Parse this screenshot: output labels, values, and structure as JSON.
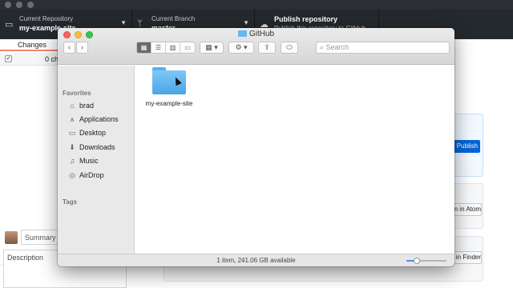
{
  "app": {
    "repository": {
      "label": "Current Repository",
      "value": "my-example-site"
    },
    "branch": {
      "label": "Current Branch",
      "value": "master"
    },
    "publish": {
      "label": "Publish repository",
      "sub": "Publish this repository to GitHub"
    },
    "sidebar": {
      "tab_changes": "Changes",
      "changes_count": "0 changed files",
      "summary_placeholder": "Summary (required)",
      "description_placeholder": "Description"
    },
    "main": {
      "publish_button": "Publish repository",
      "atom_button": "Open in Atom",
      "finder_button": "Show in Finder"
    }
  },
  "finder": {
    "title": "GitHub",
    "search_placeholder": "Search",
    "sidebar": {
      "favorites_heading": "Favorites",
      "tags_heading": "Tags",
      "items": [
        {
          "label": "brad",
          "icon": "home-icon"
        },
        {
          "label": "Applications",
          "icon": "applications-icon"
        },
        {
          "label": "Desktop",
          "icon": "desktop-icon"
        },
        {
          "label": "Downloads",
          "icon": "downloads-icon"
        },
        {
          "label": "Music",
          "icon": "music-icon"
        },
        {
          "label": "AirDrop",
          "icon": "airdrop-icon"
        }
      ]
    },
    "content": {
      "items": [
        {
          "name": "my-example-site",
          "icon": "folder-icon"
        }
      ]
    },
    "status": "1 item, 241.06 GB available",
    "icon_size_fraction": 0.25
  }
}
